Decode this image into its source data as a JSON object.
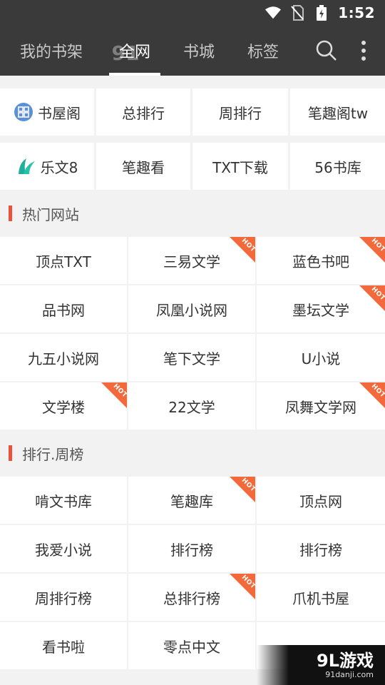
{
  "status_bar": {
    "time": "1:52"
  },
  "nav": {
    "tabs": [
      {
        "label": "我的书架"
      },
      {
        "label": "全网"
      },
      {
        "label": "书城"
      },
      {
        "label": "标签"
      }
    ],
    "watermark": "91"
  },
  "quick_links": [
    {
      "label": "书屋阁",
      "icon": "grid-app-icon"
    },
    {
      "label": "总排行"
    },
    {
      "label": "周排行"
    },
    {
      "label": "笔趣阁tw"
    },
    {
      "label": "乐文8",
      "icon": "leaf-logo-icon"
    },
    {
      "label": "笔趣看"
    },
    {
      "label": "TXT下载"
    },
    {
      "label": "56书库"
    }
  ],
  "sections": [
    {
      "title": "热门网站",
      "items": [
        {
          "label": "顶点TXT",
          "hot": false
        },
        {
          "label": "三易文学",
          "hot": true
        },
        {
          "label": "蓝色书吧",
          "hot": true
        },
        {
          "label": "品书网",
          "hot": false
        },
        {
          "label": "凤凰小说网",
          "hot": false
        },
        {
          "label": "墨坛文学",
          "hot": true
        },
        {
          "label": "九五小说网",
          "hot": false
        },
        {
          "label": "笔下文学",
          "hot": false
        },
        {
          "label": "U小说",
          "hot": false
        },
        {
          "label": "文学楼",
          "hot": true
        },
        {
          "label": "22文学",
          "hot": false
        },
        {
          "label": "凤舞文学网",
          "hot": true
        }
      ]
    },
    {
      "title": "排行.周榜",
      "items": [
        {
          "label": "啃文书库",
          "hot": false
        },
        {
          "label": "笔趣库",
          "hot": true
        },
        {
          "label": "顶点网",
          "hot": false
        },
        {
          "label": "我爱小说",
          "hot": false
        },
        {
          "label": "排行榜",
          "hot": false
        },
        {
          "label": "排行榜",
          "hot": false
        },
        {
          "label": "周排行榜",
          "hot": false
        },
        {
          "label": "总排行榜",
          "hot": true
        },
        {
          "label": "爪机书屋",
          "hot": false
        },
        {
          "label": "看书啦",
          "hot": false
        },
        {
          "label": "零点中文",
          "hot": false
        },
        {
          "label": "",
          "hot": false
        }
      ]
    }
  ],
  "hot_label": "HOT",
  "brand_watermark": {
    "main": "9L游戏",
    "sub": "91danji.com"
  },
  "colors": {
    "nav_bg": "#3a3a3a",
    "accent": "#e8533a",
    "hot": "#f26a3b"
  }
}
